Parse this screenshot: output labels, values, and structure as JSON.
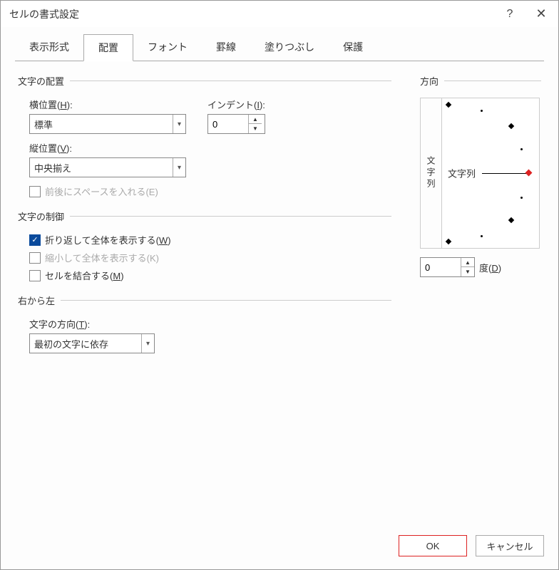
{
  "title": "セルの書式設定",
  "tabs": [
    "表示形式",
    "配置",
    "フォント",
    "罫線",
    "塗りつぶし",
    "保護"
  ],
  "active_tab_index": 1,
  "alignment": {
    "section_label": "文字の配置",
    "horizontal_label": "横位置(H):",
    "horizontal_value": "標準",
    "vertical_label": "縦位置(V):",
    "vertical_value": "中央揃え",
    "indent_label": "インデント(I):",
    "indent_value": "0",
    "justify_distributed_label": "前後にスペースを入れる(E)"
  },
  "text_control": {
    "section_label": "文字の制御",
    "wrap_label": "折り返して全体を表示する(W)",
    "wrap_checked": true,
    "shrink_label": "縮小して全体を表示する(K)",
    "shrink_checked": false,
    "merge_label": "セルを結合する(M)",
    "merge_checked": false
  },
  "rtl": {
    "section_label": "右から左",
    "direction_label": "文字の方向(T):",
    "direction_value": "最初の文字に依存"
  },
  "orientation": {
    "section_label": "方向",
    "vertical_text": "文字列",
    "angle_text": "文字列",
    "degree_value": "0",
    "degree_label": "度(D)"
  },
  "buttons": {
    "ok": "OK",
    "cancel": "キャンセル"
  }
}
